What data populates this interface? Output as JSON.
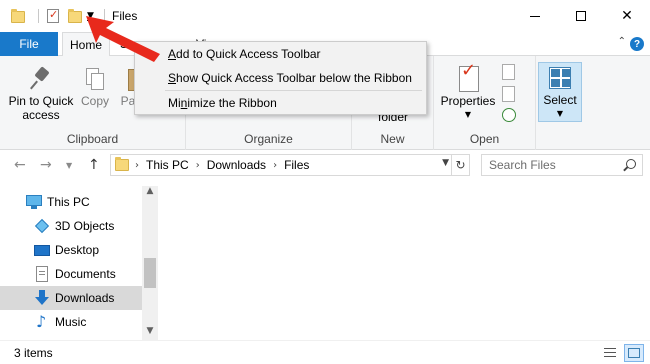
{
  "window": {
    "title": "Files",
    "qat_dropdown_glyph": "▼"
  },
  "ribbon": {
    "tabs": {
      "file": "File",
      "home": "Home",
      "share": "Share",
      "view": "View"
    },
    "clipboard": {
      "label": "Clipboard",
      "pin_line1": "Pin to Quick",
      "pin_line2": "access",
      "copy": "Copy",
      "paste": "Paste"
    },
    "organize": {
      "label": "Organize"
    },
    "new": {
      "label": "New",
      "new_folder_line2": "folder"
    },
    "open": {
      "label": "Open",
      "properties": "Properties"
    },
    "select": {
      "label": "Select"
    }
  },
  "context_menu": {
    "items": [
      {
        "accel": "A",
        "rest": "dd to Quick Access Toolbar"
      },
      {
        "accel": "S",
        "rest": "how Quick Access Toolbar below the Ribbon"
      },
      {
        "prefix": "Mi",
        "accel": "n",
        "rest": "imize the Ribbon"
      }
    ]
  },
  "address_bar": {
    "crumbs": [
      "This PC",
      "Downloads",
      "Files"
    ],
    "search_placeholder": "Search Files"
  },
  "nav_pane": {
    "items": [
      {
        "label": "This PC",
        "icon": "computer-icon"
      },
      {
        "label": "3D Objects",
        "icon": "3d-objects-icon"
      },
      {
        "label": "Desktop",
        "icon": "desktop-icon"
      },
      {
        "label": "Documents",
        "icon": "documents-icon"
      },
      {
        "label": "Downloads",
        "icon": "downloads-icon",
        "selected": true
      },
      {
        "label": "Music",
        "icon": "music-icon"
      }
    ]
  },
  "status": {
    "item_count": "3 items"
  },
  "colors": {
    "accent": "#1979ca",
    "arrow": "#e8291c"
  }
}
